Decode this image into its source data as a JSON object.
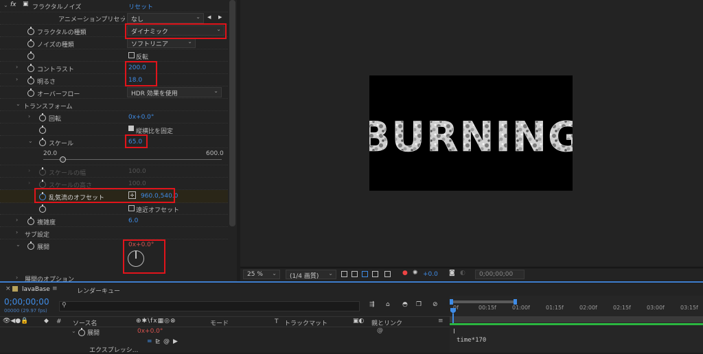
{
  "effects": {
    "effect_name": "フラクタルノイズ",
    "reset_label": "リセット",
    "animation_preset_label": "アニメーションプリセット",
    "animation_preset_value": "なし",
    "fractal_type_label": "フラクタルの種類",
    "fractal_type_value": "ダイナミック",
    "noise_type_label": "ノイズの種類",
    "noise_type_value": "ソフトリニア",
    "invert_label": "反転",
    "contrast_label": "コントラスト",
    "contrast_value": "200.0",
    "brightness_label": "明るさ",
    "brightness_value": "18.0",
    "overflow_label": "オーバーフロー",
    "overflow_value": "HDR 効果を使用",
    "transform_label": "トランスフォーム",
    "rotation_label": "回転",
    "rotation_value": "0x+0.0°",
    "uniform_scale_label": "縦横比を固定",
    "scale_label": "スケール",
    "scale_value": "65.0",
    "scale_min": "20.0",
    "scale_max": "600.0",
    "scale_width_label": "スケールの幅",
    "scale_width_value": "100.0",
    "scale_height_label": "スケールの高さ",
    "scale_height_value": "100.0",
    "offset_label": "乱気流のオフセット",
    "offset_value": "960.0,540.0",
    "perspective_offset_label": "遠近オフセット",
    "complexity_label": "複雑度",
    "complexity_value": "6.0",
    "sub_settings_label": "サブ設定",
    "evolution_label": "展開",
    "evolution_value": "0x+0.0°",
    "evolution_options_label": "展開のオプション"
  },
  "viewer": {
    "comp_text": "BURNING",
    "zoom_value": "25 %",
    "resolution_value": "(1/4 画質)",
    "exposure_value": "+0.0",
    "timecode_value": "0;00;00;00"
  },
  "timeline": {
    "comp_tab": "lavaBase",
    "menu_icon": "≡",
    "render_queue_tab": "レンダーキュー",
    "current_time": "0;00;00;00",
    "frame_info": "00000 (29.97 fps)",
    "search_placeholder": "",
    "col_source_name": "ソース名",
    "col_mode": "モード",
    "col_t": "T",
    "col_track_matte": "トラックマット",
    "col_parent": "親とリンク",
    "layer_evolution_label": "展開",
    "layer_evolution_value": "0x+0.0°",
    "expression_label": "エクスプレッシ...",
    "expression_text": "time*170",
    "ruler_labels": [
      "0f",
      "00:15f",
      "01:00f",
      "01:15f",
      "02:00f",
      "02:15f",
      "03:00f",
      "03:15f"
    ]
  },
  "colors": {
    "highlight_red": "#e2141b",
    "value_blue": "#3f8ce6",
    "keyframe_red": "#d9534f",
    "timeline_green": "#2bb640"
  }
}
